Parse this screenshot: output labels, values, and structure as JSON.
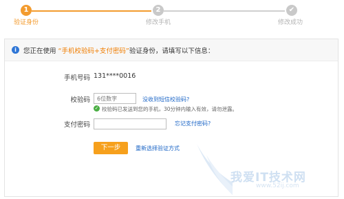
{
  "steps": [
    {
      "number": "1",
      "label": "验证身份",
      "state": "active"
    },
    {
      "number": "2",
      "label": "修改手机",
      "state": "inactive"
    },
    {
      "number": "✔",
      "label": "修改成功",
      "state": "inactive"
    }
  ],
  "notice": {
    "prefix": "您正在使用 ",
    "highlight": "“手机校验码+支付密码”",
    "suffix": "验证身份，请填写以下信息："
  },
  "phone": {
    "label": "手机号码",
    "value": "131****0016"
  },
  "code": {
    "label": "校验码",
    "placeholder": "6位数字",
    "link": "没收到短信校验码?",
    "hint": "校验码已发送到您的手机，30分钟内输入有效，请勿泄露。"
  },
  "password": {
    "label": "支付密码",
    "link": "忘记支付密码?"
  },
  "actions": {
    "next": "下一步",
    "reselect": "重新选择验证方式"
  },
  "watermark": {
    "text": "我爱IT技术网",
    "url": "www.52ij.com"
  },
  "colors": {
    "accent": "#f39b2e",
    "link": "#1a64c6",
    "success": "#4aae43",
    "info": "#2f76d6"
  }
}
